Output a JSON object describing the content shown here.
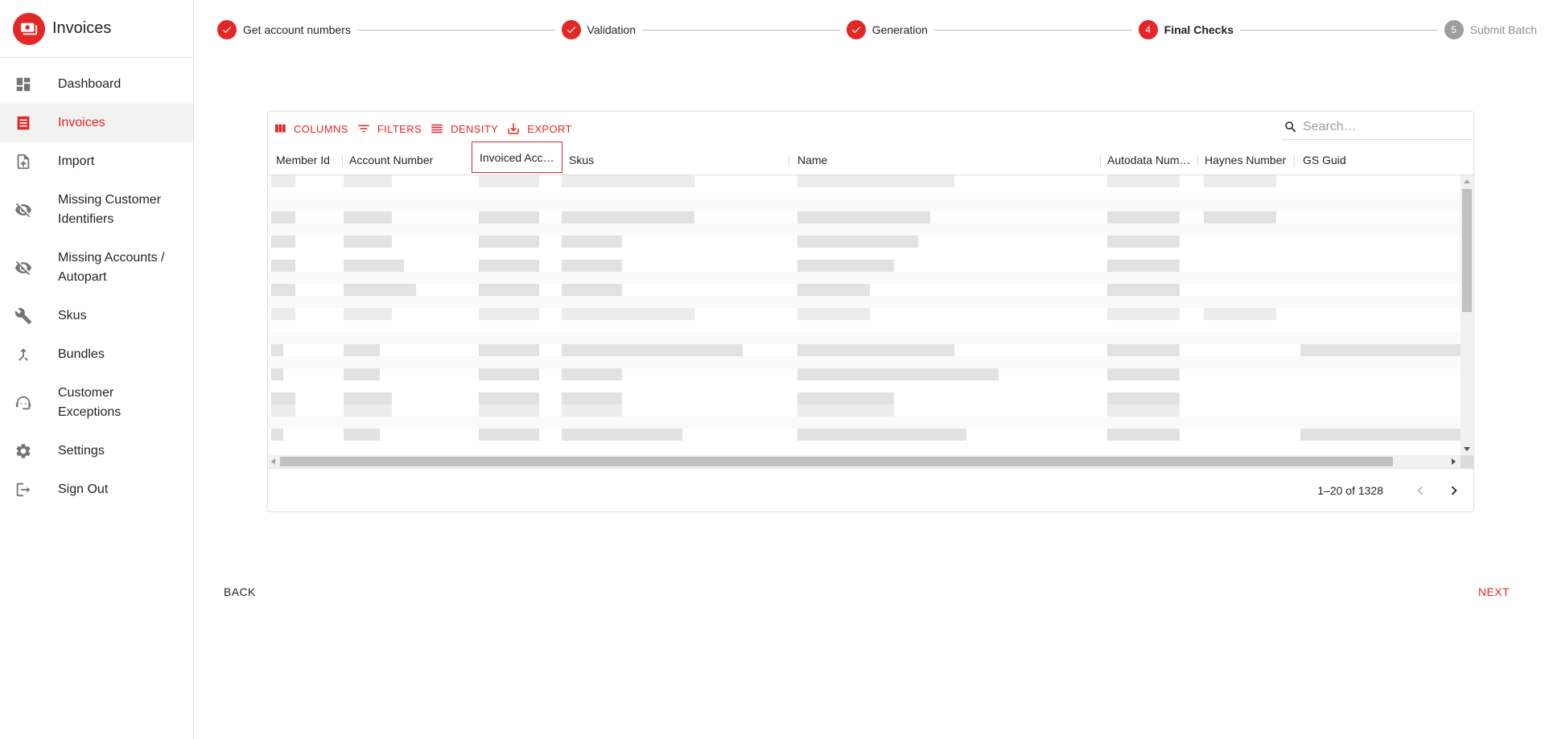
{
  "app": {
    "title": "Invoices",
    "accent_color": "#e32626"
  },
  "sidebar": {
    "items": [
      {
        "label": "Dashboard",
        "icon": "dashboard-icon",
        "active": false
      },
      {
        "label": "Invoices",
        "icon": "receipt-icon",
        "active": true
      },
      {
        "label": "Import",
        "icon": "upload-file-icon",
        "active": false
      },
      {
        "label": "Missing Customer Identifiers",
        "icon": "visibility-off-icon",
        "active": false
      },
      {
        "label": "Missing Accounts / Autopart",
        "icon": "visibility-off-icon",
        "active": false
      },
      {
        "label": "Skus",
        "icon": "wrench-icon",
        "active": false
      },
      {
        "label": "Bundles",
        "icon": "merge-icon",
        "active": false
      },
      {
        "label": "Customer Exceptions",
        "icon": "support-agent-icon",
        "active": false
      },
      {
        "label": "Settings",
        "icon": "gear-icon",
        "active": false
      },
      {
        "label": "Sign Out",
        "icon": "logout-icon",
        "active": false
      }
    ]
  },
  "stepper": {
    "steps": [
      {
        "label": "Get account numbers",
        "state": "completed",
        "number": "1"
      },
      {
        "label": "Validation",
        "state": "completed",
        "number": "2"
      },
      {
        "label": "Generation",
        "state": "completed",
        "number": "3"
      },
      {
        "label": "Final Checks",
        "state": "active",
        "number": "4"
      },
      {
        "label": "Submit Batch",
        "state": "pending",
        "number": "5"
      }
    ]
  },
  "grid": {
    "toolbar": {
      "columns_label": "COLUMNS",
      "filters_label": "FILTERS",
      "density_label": "DENSITY",
      "export_label": "EXPORT",
      "search_placeholder": "Search…",
      "search_value": ""
    },
    "columns": [
      {
        "label": "Member Id"
      },
      {
        "label": "Account Number"
      },
      {
        "label": "Invoiced Acc…",
        "focused": true
      },
      {
        "label": "Skus"
      },
      {
        "label": "Name"
      },
      {
        "label": "Autodata Num…"
      },
      {
        "label": "Haynes Number"
      },
      {
        "label": "GS Guid"
      }
    ],
    "rows_note": "cell contents pixelated/redacted",
    "pagination": {
      "range_text": "1–20 of 1328"
    }
  },
  "actions": {
    "back_label": "BACK",
    "next_label": "NEXT"
  }
}
